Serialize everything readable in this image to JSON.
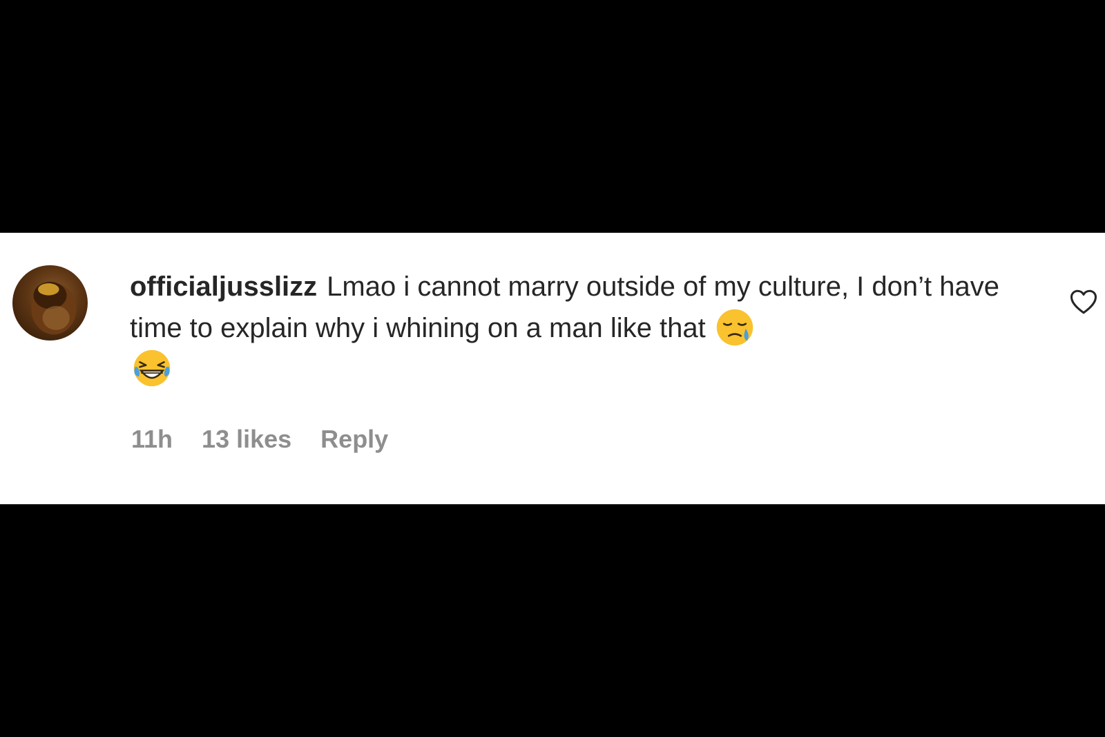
{
  "comment": {
    "username": "officialjusslizz",
    "text": "Lmao i cannot marry outside of my culture, I don’t have time to explain why i whining on a man like that",
    "emojis": [
      "disappointed-relieved-face",
      "grinning-squinting-crying-face"
    ],
    "timestamp": "11h",
    "likes": "13 likes",
    "reply_label": "Reply"
  },
  "icons": {
    "like": "heart-outline-icon"
  },
  "colors": {
    "background": "#000000",
    "card": "#ffffff",
    "text": "#262626",
    "meta": "#8e8e8e"
  }
}
